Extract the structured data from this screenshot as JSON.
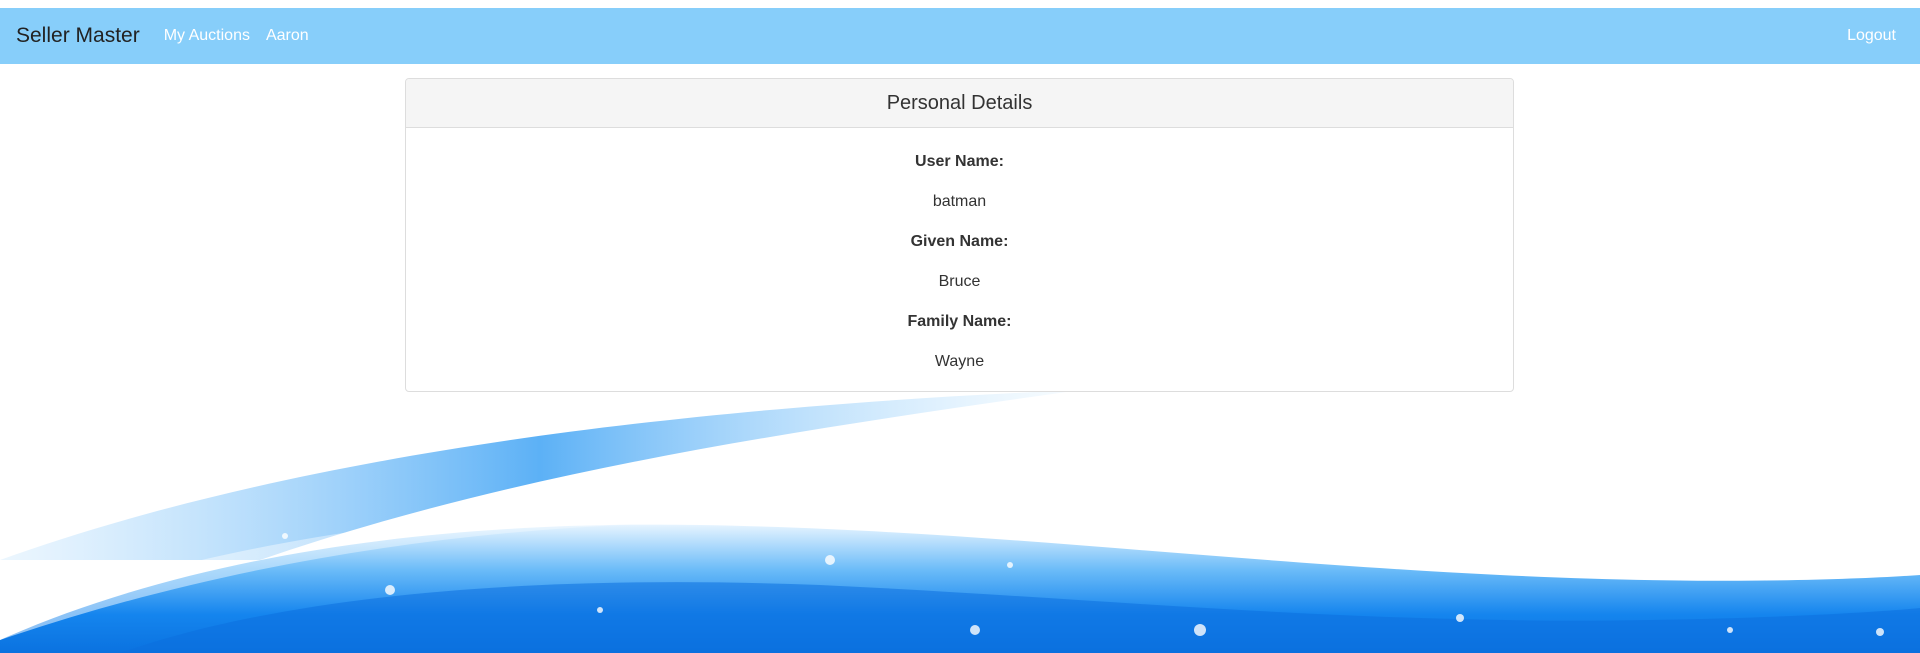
{
  "navbar": {
    "brand": "Seller Master",
    "links": [
      {
        "label": "My Auctions"
      },
      {
        "label": "Aaron"
      }
    ],
    "logout_label": "Logout",
    "background_color": "#87cefa"
  },
  "panel": {
    "heading": "Personal Details",
    "fields": [
      {
        "label": "User Name:",
        "value": "batman"
      },
      {
        "label": "Given Name:",
        "value": "Bruce"
      },
      {
        "label": "Family Name:",
        "value": "Wayne"
      }
    ]
  },
  "colors": {
    "wave_primary": "#1e88f0",
    "wave_light": "#8ccafa"
  }
}
